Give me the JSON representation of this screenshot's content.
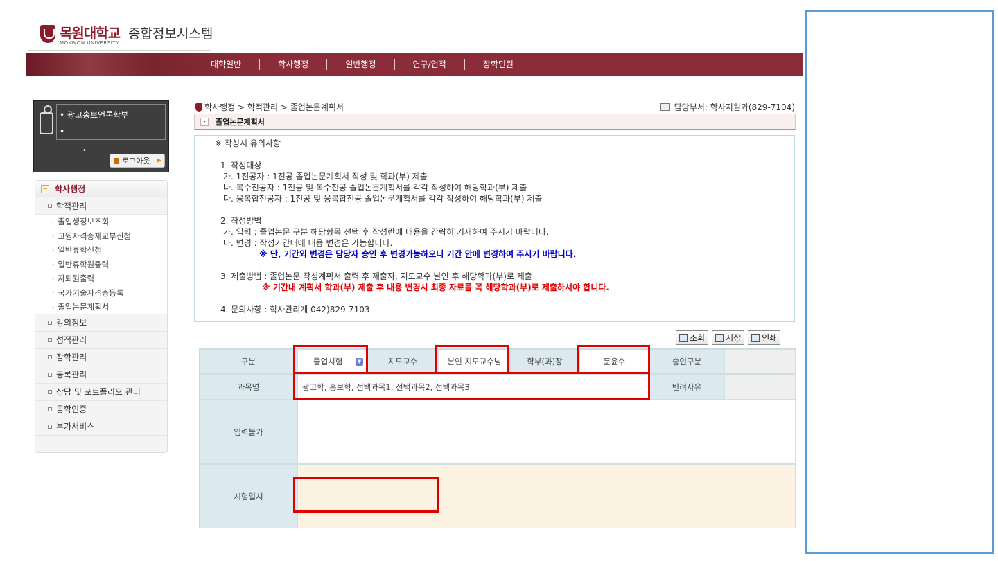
{
  "header": {
    "logo_name": "목원대학교",
    "logo_eng": "MOKWON UNIVERSITY",
    "system_title": "종합정보시스템"
  },
  "topnav": [
    "대학일반",
    "학사행정",
    "일반행정",
    "연구/업적",
    "장학민원"
  ],
  "profile": {
    "department": "광고홍보언론학부",
    "line2": "",
    "logout_label": "로그아웃"
  },
  "sidemenu": {
    "head": "학사행정",
    "categories": [
      {
        "label": "학적관리",
        "items": [
          "졸업생정보조회",
          "교원자격증재교부신청",
          "일반휴학신청",
          "일반휴학원출력",
          "자퇴원출력",
          "국가기술자격증등록",
          "졸업논문계획서"
        ]
      },
      {
        "label": "강의정보"
      },
      {
        "label": "성적관리"
      },
      {
        "label": "장학관리"
      },
      {
        "label": "등록관리"
      },
      {
        "label": "상담 및 포트폴리오 관리"
      },
      {
        "label": "공학인증"
      },
      {
        "label": "부가서비스"
      }
    ]
  },
  "breadcrumb": "학사행정 > 학적관리 > 졸업논문계획서",
  "dept_info": "담당부서: 학사지원과(829-7104)",
  "page_title": "졸업논문계획서",
  "notice": {
    "heading": "※ 작성시 유의사항",
    "s1_title": "1. 작성대상",
    "s1_a": "가. 1전공자  : 1전공 졸업논문계획서 작성 및 학과(부) 제출",
    "s1_b": "나. 복수전공자 : 1전공 및 복수전공 졸업논문계획서를 각각 작성하여 해당학과(부) 제출",
    "s1_c": "다. 융복합전공자 : 1전공 및 융복합전공 졸업논문계획서를 각각 작성하여 해당학과(부) 제출",
    "s2_title": "2. 작성방법",
    "s2_a": "가. 입력 : 졸업논문 구분 해당항목 선택 후 작성란에 내용을 간략히 기재하여 주시기 바랍니다.",
    "s2_b": "나. 변경 : 작성기간내에 내용 변경은 가능합니다.",
    "s2_note": "※ 단, 기간외 변경은 담당자 승인 후 변경가능하오니 기간 안에 변경하여 주시기 바랍니다.",
    "s3_title": "3. 제출방법 : 졸업논문 작성계획서 출력 후  제출자, 지도교수 날인 후 해당학과(부)로 제출",
    "s3_note": "※ 기간내 계획서 학과(부) 제출 후 내용 변경시 최종 자료를 꼭 해당학과(부)로 제출하셔야 합니다.",
    "s4": "4. 문의사항 : 학사관리계 042)829-7103"
  },
  "toolbar": {
    "search": "조회",
    "save": "저장",
    "print": "인쇄"
  },
  "form": {
    "type_label": "구분",
    "type_value": "졸업시험",
    "advisor_label": "지도교수",
    "advisor_value": "본인 지도교수님",
    "dept_head_label": "학부(과)장",
    "dept_head_value": "문윤수",
    "approval_label": "승인구분",
    "approval_value": "",
    "subject_label": "과목명",
    "subject_value": "광고학, 홍보학, 선택과목1, 선택과목2, 선택과목3",
    "reject_label": "반려사유",
    "reject_value": "",
    "input_label": "입력불가",
    "exam_date_label": "시험일시",
    "exam_date_value": ""
  },
  "colors": {
    "brand": "#8b1c2a",
    "highlight": "#e00000",
    "panel_border": "#5b9bd5"
  }
}
